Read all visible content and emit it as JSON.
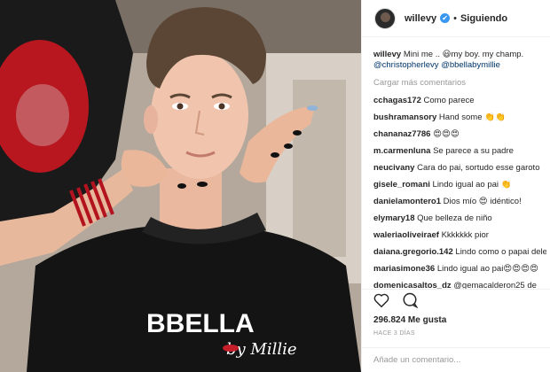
{
  "post": {
    "username": "willevy",
    "verified_glyph": "✔",
    "separator": "•",
    "follow_status": "Siguiendo",
    "caption_user": "willevy",
    "caption_text": "Mini me .. 😃my boy. my champ. ",
    "caption_mention_1": "@christopherlevy",
    "caption_mention_2": "@bbellabymillie",
    "load_more": "Cargar más comentarios",
    "likes": "296.824 Me gusta",
    "time_ago": "HACE 3 DÍAS",
    "add_comment_placeholder": "Añade un comentario..."
  },
  "comments": [
    {
      "user": "cchagas172",
      "text": "Como parece"
    },
    {
      "user": "bushramansory",
      "text": "Hand some 👏👏"
    },
    {
      "user": "chananaz7786",
      "text": "😍😍😍"
    },
    {
      "user": "m.carmenluna",
      "text": "Se parece a su padre"
    },
    {
      "user": "neucivany",
      "text": "Cara do pai, sortudo esse garoto"
    },
    {
      "user": "gisele_romani",
      "text": "Lindo igual ao pai 👏"
    },
    {
      "user": "danielamontero1",
      "text": "Dios mío 😍 idéntico!"
    },
    {
      "user": "elymary18",
      "text": "Que belleza de niño"
    },
    {
      "user": "waleriaoliveiraef",
      "text": "Kkkkkkk pior"
    },
    {
      "user": "daiana.gregorio.142",
      "text": "Lindo como o papai dele.😍😍😍"
    },
    {
      "user": "mariasimone36",
      "text": "Lindo igual ao pai😍😍😍😍"
    },
    {
      "user": "domenicasaltos_dz",
      "text": "@gemacalderon25 de"
    }
  ],
  "photo": {
    "cape_brand": "BBELLA",
    "cape_sub": "by Millie"
  },
  "icons": {
    "like": "heart-icon",
    "comment": "comment-icon"
  },
  "colors": {
    "link": "#003569",
    "verified": "#3897f0",
    "muted": "#999999"
  }
}
